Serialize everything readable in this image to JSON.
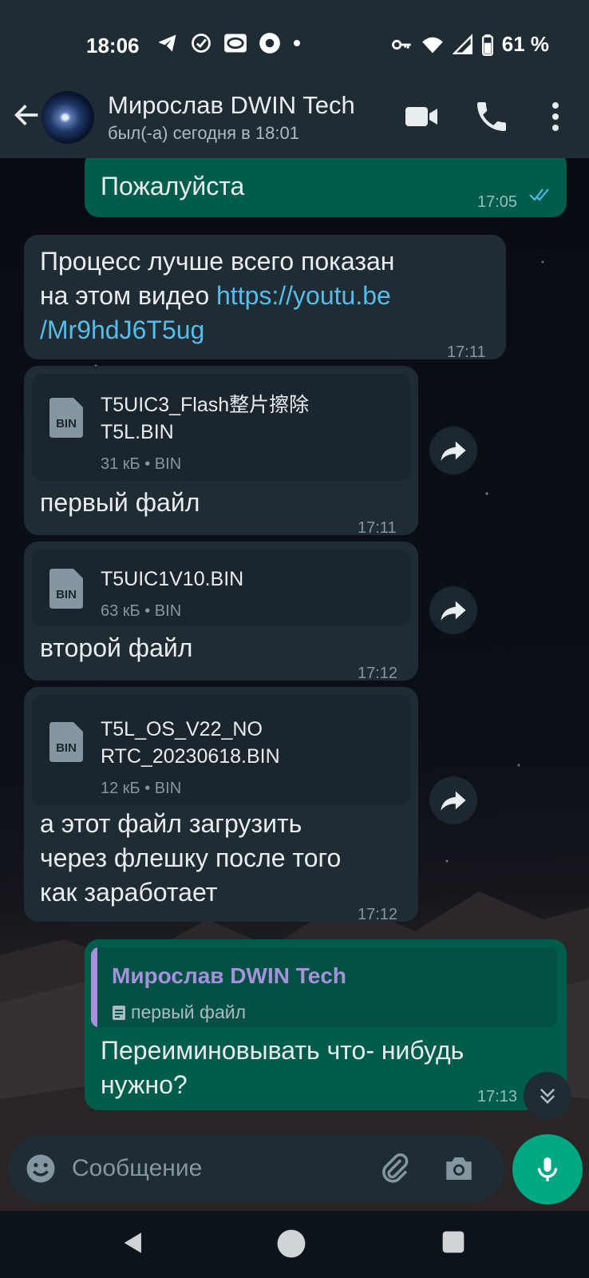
{
  "status_bar": {
    "time": "18:06",
    "battery": "61 %"
  },
  "header": {
    "contact_name": "Мирослав DWIN Tech",
    "last_seen": "был(-а) сегодня в 18:01"
  },
  "messages": [
    {
      "kind": "out",
      "text": "Пожалуйста",
      "time": "17:05",
      "read": true
    },
    {
      "kind": "in",
      "text_before_link": "Процесс лучше всего показан\nна этом видео ",
      "link": "https://youtu.be\n/Mr9hdJ6T5ug",
      "time": "17:11"
    },
    {
      "kind": "in-doc",
      "file_name": "T5UIC3_Flash整片擦除\nT5L.BIN",
      "file_meta": "31 кБ • BIN",
      "caption": "первый файл",
      "time": "17:11"
    },
    {
      "kind": "in-doc",
      "file_name": "T5UIC1V10.BIN",
      "file_meta": "63 кБ • BIN",
      "caption": "второй файл",
      "time": "17:12"
    },
    {
      "kind": "in-doc",
      "file_name": "T5L_OS_V22_NO\nRTC_20230618.BIN",
      "file_meta": "12 кБ • BIN",
      "caption": "а этот файл загрузить\nчерез флешку после того\nкак заработает",
      "time": "17:12"
    },
    {
      "kind": "out-reply",
      "quote_author": "Мирослав DWIN Tech",
      "quote_text": "первый файл",
      "text": "Переиминовывать что- нибудь\nнужно?",
      "time": "17:13"
    }
  ],
  "file_icon_label": "BIN",
  "composer": {
    "placeholder": "Сообщение"
  },
  "colors": {
    "header_bg": "#1f2c34",
    "incoming_bubble": "#1f2c34",
    "outgoing_bubble": "#005c4b",
    "accent_green": "#00a884",
    "link": "#53bdeb",
    "read_ticks": "#53bdeb",
    "quote_author": "#a791dc"
  },
  "icons": {
    "back": "arrow-left-icon",
    "video_call": "video-camera-icon",
    "voice_call": "phone-icon",
    "menu": "more-vert-icon",
    "forward": "forward-arrow-icon",
    "emoji": "emoji-icon",
    "attach": "paperclip-icon",
    "camera": "camera-icon",
    "mic": "microphone-icon",
    "scroll_down": "double-chevron-down-icon"
  }
}
